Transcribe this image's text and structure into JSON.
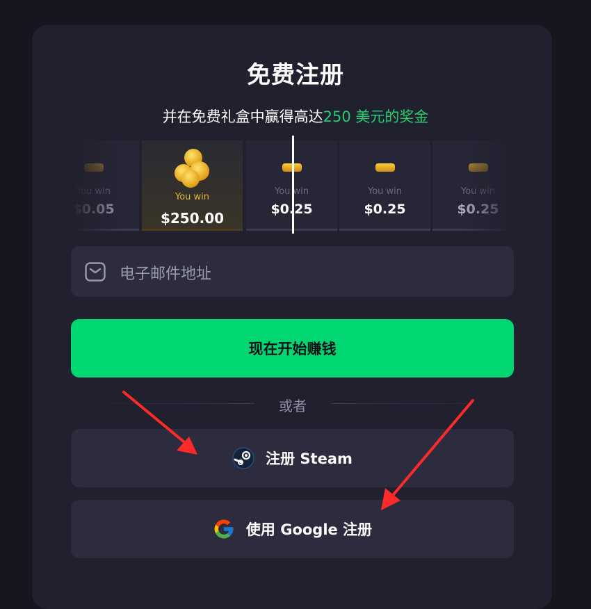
{
  "signup": {
    "title": "免费注册",
    "subtitle_prefix": "并在免费礼盒中赢得高达",
    "subtitle_highlight": "250 美元的奖金"
  },
  "reel": {
    "tiles": [
      {
        "label": "You win",
        "amount": "$0.05"
      },
      {
        "label": "You win",
        "amount": "$250.00"
      },
      {
        "label": "You win",
        "amount": "$0.25"
      },
      {
        "label": "You win",
        "amount": "$0.25"
      },
      {
        "label": "You win",
        "amount": "$0.25"
      }
    ]
  },
  "email_field": {
    "placeholder": "电子邮件地址"
  },
  "primary_button": {
    "label": "现在开始赚钱"
  },
  "divider": {
    "label": "或者"
  },
  "steam_button": {
    "label": "注册 Steam",
    "icon": "steam-icon"
  },
  "google_button": {
    "label": "使用 Google 注册",
    "icon": "google-icon"
  },
  "colors": {
    "background": "#16161f",
    "card": "#20202e",
    "accent_green": "#00d672",
    "highlight_text": "#22d06f",
    "button_dark": "#2c2c3e",
    "annotation_arrow": "#ff2a2a"
  }
}
